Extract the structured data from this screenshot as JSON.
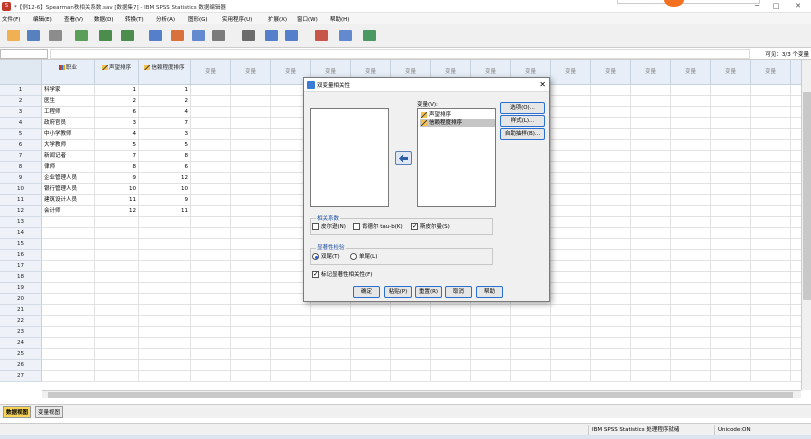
{
  "window": {
    "title": "*【例12-6】Spearman秩相关系数.sav [数据集7] - IBM SPSS Statistics 数据编辑器"
  },
  "menu": [
    "文件(F)",
    "编辑(E)",
    "查看(V)",
    "数据(D)",
    "转换(T)",
    "分析(A)",
    "图形(G)",
    "实用程序(U)",
    "扩展(X)",
    "窗口(W)",
    "帮助(H)"
  ],
  "toolbar_icons": [
    "open-folder-icon",
    "save-icon",
    "print-icon",
    "recall-dialog-icon",
    "undo-icon",
    "redo-icon",
    "goto-case-icon",
    "goto-variable-icon",
    "variables-icon",
    "run-descriptives-icon",
    "find-icon",
    "insert-cases-icon",
    "insert-variable-icon",
    "split-file-icon",
    "weight-cases-icon",
    "value-labels-icon",
    "use-sets-icon"
  ],
  "varbar": {
    "visible": "可见：3/3 个变量"
  },
  "columns": [
    {
      "label": "职业",
      "icon": "nominal"
    },
    {
      "label": "声望排序",
      "icon": "scale"
    },
    {
      "label": "信赖程度排序",
      "icon": "scale"
    }
  ],
  "empty_col_label": "变量",
  "rows": [
    [
      "科学家",
      "1",
      "1"
    ],
    [
      "医生",
      "2",
      "2"
    ],
    [
      "工程师",
      "6",
      "4"
    ],
    [
      "政府官员",
      "3",
      "7"
    ],
    [
      "中小学教师",
      "4",
      "3"
    ],
    [
      "大学教师",
      "5",
      "5"
    ],
    [
      "新闻记者",
      "7",
      "8"
    ],
    [
      "律师",
      "8",
      "6"
    ],
    [
      "企业管理人员",
      "9",
      "12"
    ],
    [
      "银行管理人员",
      "10",
      "10"
    ],
    [
      "建筑设计人员",
      "11",
      "9"
    ],
    [
      "会计师",
      "12",
      "11"
    ]
  ],
  "row_numbers": [
    "1",
    "2",
    "3",
    "4",
    "5",
    "6",
    "7",
    "8",
    "9",
    "10",
    "11",
    "12",
    "13",
    "14",
    "15",
    "16",
    "17",
    "18",
    "19",
    "20",
    "21",
    "22",
    "23",
    "24",
    "25",
    "26",
    "27"
  ],
  "tabs": {
    "data_view": "数据视图",
    "variable_view": "变量视图"
  },
  "status": {
    "processor": "IBM SPSS Statistics 处理程序就绪",
    "unicode": "Unicode:ON"
  },
  "dialog": {
    "title": "双变量相关性",
    "target_label": "变量(V):",
    "target_vars": [
      "声望排序",
      "信赖程度排序"
    ],
    "buttons_right": [
      "选项(O)...",
      "样式(L)...",
      "自助抽样(B)..."
    ],
    "coef_group": "相关系数",
    "coef": [
      {
        "label": "皮尔逊(N)",
        "checked": false
      },
      {
        "label": "肯德尔 tau-b(K)",
        "checked": false
      },
      {
        "label": "斯皮尔曼(S)",
        "checked": true
      }
    ],
    "sig_group": "显著性检验",
    "sig": [
      {
        "label": "双尾(T)",
        "selected": true
      },
      {
        "label": "单尾(L)",
        "selected": false
      }
    ],
    "flag": {
      "label": "标记显著性相关性(F)",
      "checked": true
    },
    "footer_buttons": [
      "确定",
      "粘贴(P)",
      "重置(R)",
      "取消",
      "帮助"
    ]
  }
}
